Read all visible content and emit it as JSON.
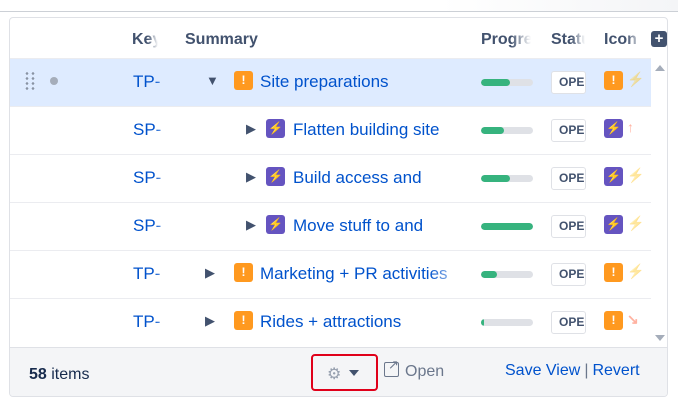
{
  "header": {
    "key": "Key",
    "summary": "Summary",
    "progress": "Progress",
    "status": "Status",
    "icon": "Icon",
    "add_column": "+"
  },
  "rows": [
    {
      "key": "TP-",
      "summary": "Site preparations",
      "type": "epic",
      "type_icon": "!",
      "expanded": true,
      "progress": 0.55,
      "status": "OPEN",
      "priority_icon": "⚡",
      "selected": true
    },
    {
      "key": "SP-",
      "summary": "Flatten building site",
      "type": "feature",
      "type_icon": "⚡",
      "expanded": false,
      "progress": 0.45,
      "status": "OPEN",
      "priority_icon": "↑",
      "selected": false
    },
    {
      "key": "SP-",
      "summary": "Build access and",
      "type": "feature",
      "type_icon": "⚡",
      "expanded": false,
      "progress": 0.55,
      "status": "OPEN",
      "priority_icon": "⚡",
      "selected": false
    },
    {
      "key": "SP-",
      "summary": "Move stuff to and",
      "type": "feature",
      "type_icon": "⚡",
      "expanded": false,
      "progress": 1.0,
      "status": "OPEN",
      "priority_icon": "⚡",
      "selected": false
    },
    {
      "key": "TP-",
      "summary": "Marketing + PR activities",
      "type": "epic",
      "type_icon": "!",
      "expanded": false,
      "progress": 0.3,
      "status": "OPEN",
      "priority_icon": "⚡",
      "selected": false
    },
    {
      "key": "TP-",
      "summary": "Rides + attractions",
      "type": "epic",
      "type_icon": "!",
      "expanded": false,
      "progress": 0.06,
      "status": "OPEN",
      "priority_icon": "↘",
      "selected": false
    }
  ],
  "footer": {
    "count": "58",
    "count_suffix": " items",
    "gear": "⚙",
    "open": "Open",
    "save_view": "Save View",
    "separator": "|",
    "revert": "Revert"
  },
  "colors": {
    "link": "#0052cc",
    "epic": "#ff991f",
    "feature": "#6554c0",
    "progress": "#36b37e",
    "highlight": "#e0001a"
  }
}
